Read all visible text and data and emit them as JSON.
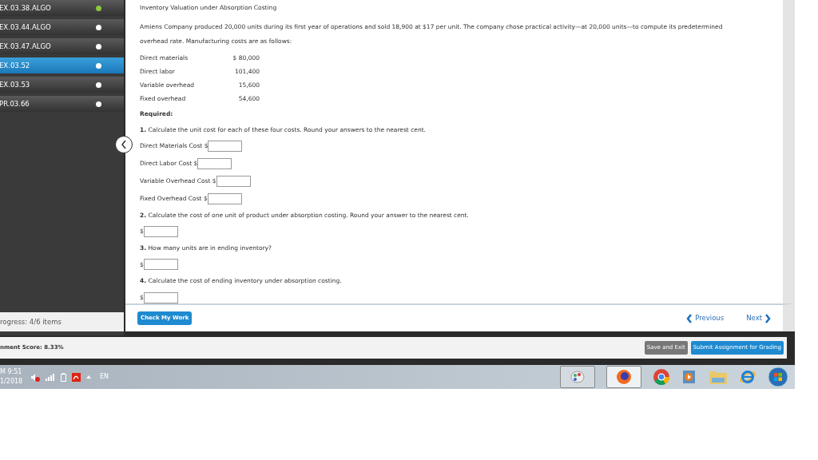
{
  "sidebar": {
    "items": [
      {
        "label": "EX.03.38.ALGO",
        "selected": false,
        "color": "#8cc63f"
      },
      {
        "label": "EX.03.44.ALGO",
        "selected": false,
        "color": "#ffffff"
      },
      {
        "label": "EX.03.47.ALGO",
        "selected": false,
        "color": "#ffffff"
      },
      {
        "label": "EX.03.52",
        "selected": true,
        "color": "#ffffff"
      },
      {
        "label": "EX.03.53",
        "selected": false,
        "color": "#ffffff"
      },
      {
        "label": "PR.03.66",
        "selected": false,
        "color": "#ffffff"
      }
    ],
    "progress": "rogress: 4/6 items"
  },
  "content": {
    "title": "Inventory Valuation under Absorption Costing",
    "intro": "Amiens Company produced 20,000 units during its first year of operations and sold 18,900 at $17 per unit. The company chose practical activity—at 20,000 units—to compute its predetermined overhead rate. Manufacturing costs are as follows:",
    "costs": [
      {
        "label": "Direct materials",
        "amount": "$ 80,000"
      },
      {
        "label": "Direct labor",
        "amount": "101,400"
      },
      {
        "label": "Variable overhead",
        "amount": "15,600"
      },
      {
        "label": "Fixed overhead",
        "amount": "54,600"
      }
    ],
    "required": "Required:",
    "questions": [
      {
        "prompt": "**1.** Calculate the unit cost for each of these four costs. Round your answers to the nearest cent.",
        "fields": [
          {
            "label": "Direct Materials Cost $"
          },
          {
            "label": "Direct Labor Cost $"
          },
          {
            "label": "Variable Overhead Cost $"
          },
          {
            "label": "Fixed Overhead Cost $"
          }
        ]
      },
      {
        "prompt": "**2.** Calculate the cost of one unit of product under absorption costing. Round your answer to the nearest cent.",
        "fields": [
          {
            "label": "$"
          }
        ]
      },
      {
        "prompt": "**3.** How many units are in ending inventory?",
        "fields": [
          {
            "label": "$"
          }
        ]
      },
      {
        "prompt": "**4.** Calculate the cost of ending inventory under absorption costing.",
        "fields": [
          {
            "label": "$"
          }
        ]
      }
    ]
  },
  "nav": {
    "check": "Check My Work",
    "previous": "Previous",
    "next": "Next"
  },
  "footer": {
    "score": "nment Score: 8.33%",
    "save": "Save and Exit",
    "submit": "Submit Assignment for Grading"
  },
  "taskbar": {
    "time": "M 9:51",
    "date": "1/2018",
    "language": "EN"
  }
}
